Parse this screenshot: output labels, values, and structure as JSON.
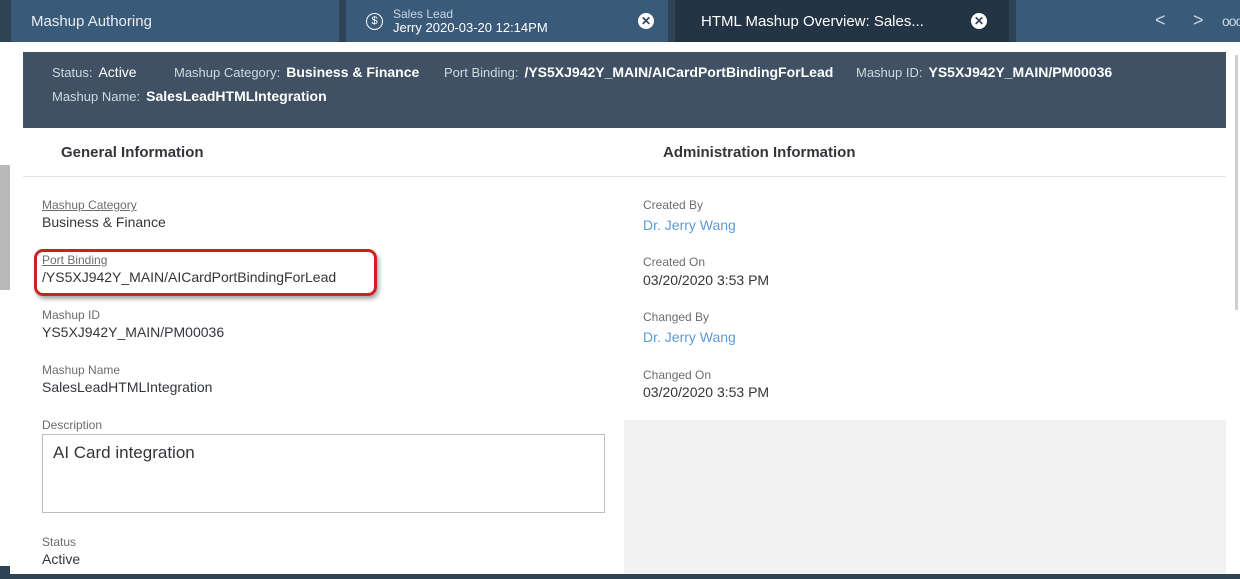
{
  "tabs": {
    "home": {
      "label": "Mashup Authoring"
    },
    "lead": {
      "title": "Sales Lead",
      "subtitle": "Jerry 2020-03-20 12:14PM",
      "icon": "dollar-icon"
    },
    "active": {
      "label": "HTML Mashup Overview: Sales..."
    },
    "nav": {
      "prev": "<",
      "next": ">",
      "more": "ooo"
    }
  },
  "header": {
    "status_label": "Status:",
    "status_value": "Active",
    "category_label": "Mashup Category:",
    "category_value": "Business & Finance",
    "port_label": "Port Binding:",
    "port_value": "/YS5XJ942Y_MAIN/AICardPortBindingForLead",
    "id_label": "Mashup ID:",
    "id_value": "YS5XJ942Y_MAIN/PM00036",
    "name_label": "Mashup Name:",
    "name_value": "SalesLeadHTMLIntegration"
  },
  "general": {
    "title": "General Information",
    "category_label": "Mashup Category",
    "category_value": "Business & Finance",
    "port_label": "Port Binding",
    "port_value": "/YS5XJ942Y_MAIN/AICardPortBindingForLead",
    "id_label": "Mashup ID",
    "id_value": "YS5XJ942Y_MAIN/PM00036",
    "name_label": "Mashup Name",
    "name_value": "SalesLeadHTMLIntegration",
    "description_label": "Description",
    "description_value": "AI Card integration",
    "status_label": "Status",
    "status_value": "Active"
  },
  "admin": {
    "title": "Administration Information",
    "created_by_label": "Created By",
    "created_by_value": "Dr. Jerry Wang",
    "created_on_label": "Created On",
    "created_on_value": "03/20/2020 3:53 PM",
    "changed_by_label": "Changed By",
    "changed_by_value": "Dr. Jerry Wang",
    "changed_on_label": "Changed On",
    "changed_on_value": "03/20/2020 3:53 PM"
  },
  "colors": {
    "tabbar": "#2e4356",
    "header": "#3f5162",
    "link": "#5b9bd5",
    "highlight": "#cf2020"
  }
}
